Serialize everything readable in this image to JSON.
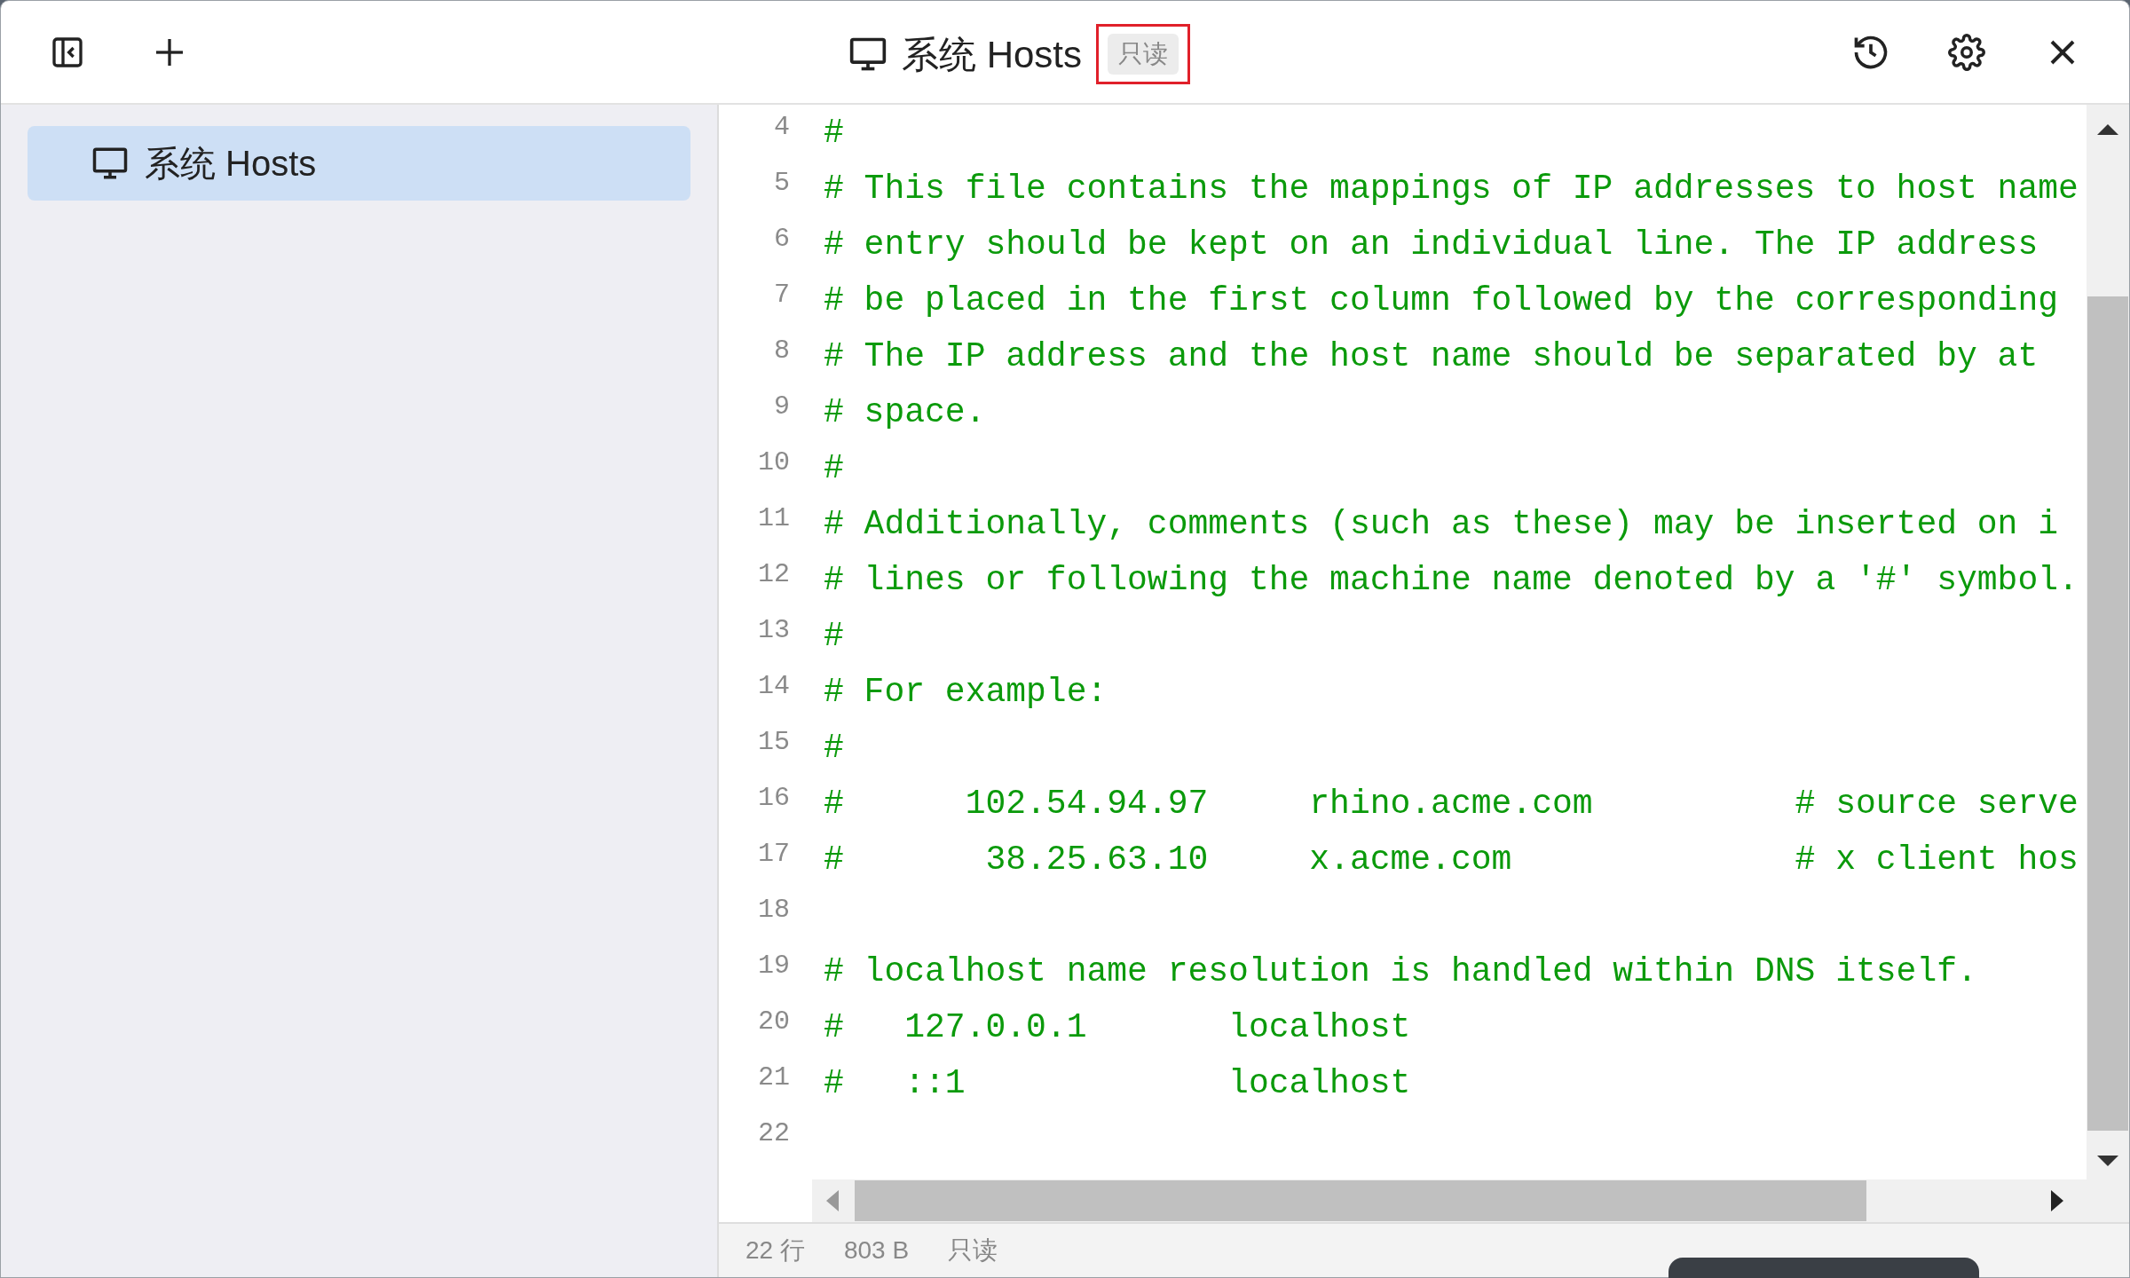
{
  "title_bar": {
    "title": "系统 Hosts",
    "badge": "只读"
  },
  "sidebar": {
    "items": [
      {
        "label": "系统 Hosts",
        "selected": true
      }
    ]
  },
  "editor": {
    "lines": [
      {
        "number": "4",
        "text": "#"
      },
      {
        "number": "5",
        "text": "# This file contains the mappings of IP addresses to host name"
      },
      {
        "number": "6",
        "text": "# entry should be kept on an individual line. The IP address"
      },
      {
        "number": "7",
        "text": "# be placed in the first column followed by the corresponding"
      },
      {
        "number": "8",
        "text": "# The IP address and the host name should be separated by at"
      },
      {
        "number": "9",
        "text": "# space."
      },
      {
        "number": "10",
        "text": "#"
      },
      {
        "number": "11",
        "text": "# Additionally, comments (such as these) may be inserted on i"
      },
      {
        "number": "12",
        "text": "# lines or following the machine name denoted by a '#' symbol."
      },
      {
        "number": "13",
        "text": "#"
      },
      {
        "number": "14",
        "text": "# For example:"
      },
      {
        "number": "15",
        "text": "#"
      },
      {
        "number": "16",
        "text": "#      102.54.94.97     rhino.acme.com          # source serve"
      },
      {
        "number": "17",
        "text": "#       38.25.63.10     x.acme.com              # x client hos"
      },
      {
        "number": "18"
      },
      {
        "number": "19",
        "text": "# localhost name resolution is handled within DNS itself."
      },
      {
        "number": "20",
        "text": "#   127.0.0.1       localhost"
      },
      {
        "number": "21",
        "text": "#   ::1             localhost"
      },
      {
        "number": "22"
      }
    ]
  },
  "status_bar": [
    "22 行",
    "803 B",
    "只读"
  ]
}
